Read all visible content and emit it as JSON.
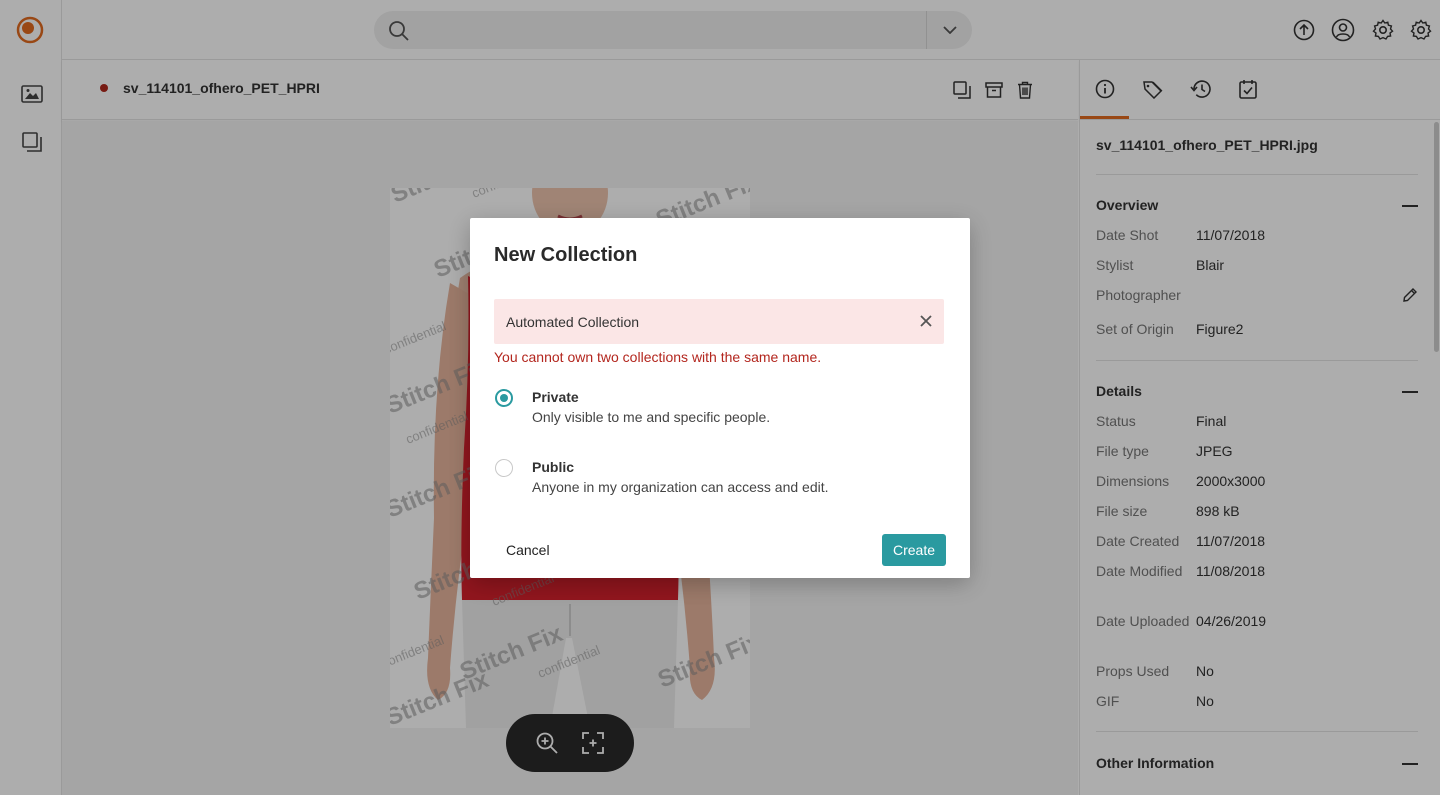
{
  "app": {
    "logo_icon": "app-logo",
    "accent_color": "#e26a1f"
  },
  "left_rail": {
    "items": [
      {
        "icon": "image-icon"
      },
      {
        "icon": "collections-icon"
      }
    ]
  },
  "top_bar": {
    "search": {
      "value": "",
      "placeholder": ""
    },
    "icons": [
      "upload-icon",
      "user-icon",
      "gear-icon",
      "settings-icon"
    ]
  },
  "asset_header": {
    "title": "sv_114101_ofhero_PET_HPRI",
    "status_color": "#b0281c",
    "actions": [
      "copy-icon",
      "archive-icon",
      "trash-icon"
    ]
  },
  "viewer": {
    "controls": [
      "zoom-in-icon",
      "fit-screen-icon"
    ]
  },
  "right_panel": {
    "tabs": [
      "info-icon",
      "tags-icon",
      "history-icon",
      "tasks-icon"
    ],
    "active_tab": "info-icon",
    "file_name": "sv_114101_ofhero_PET_HPRI.jpg",
    "overview": {
      "title": "Overview",
      "rows": [
        {
          "label": "Date Shot",
          "value": "11/07/2018"
        },
        {
          "label": "Stylist",
          "value": "Blair"
        },
        {
          "label": "Photographer",
          "value": ""
        },
        {
          "label": "Set of Origin",
          "value": "Figure2"
        }
      ]
    },
    "details": {
      "title": "Details",
      "rows": [
        {
          "label": "Status",
          "value": "Final"
        },
        {
          "label": "File type",
          "value": "JPEG"
        },
        {
          "label": "Dimensions",
          "value": "2000x3000"
        },
        {
          "label": "File size",
          "value": "898 kB"
        },
        {
          "label": "Date Created",
          "value": "11/07/2018"
        },
        {
          "label": "Date Modified",
          "value": "11/08/2018"
        },
        {
          "label": "Date Uploaded",
          "value": "04/26/2019"
        },
        {
          "label": "Props Used",
          "value": "No"
        },
        {
          "label": "GIF",
          "value": "No"
        }
      ]
    },
    "other": {
      "title": "Other Information"
    }
  },
  "modal": {
    "title": "New Collection",
    "name_value": "Automated Collection",
    "error": "You cannot own two collections with the same name.",
    "options": [
      {
        "title": "Private",
        "desc": "Only visible to me and specific people.",
        "checked": true
      },
      {
        "title": "Public",
        "desc": "Anyone in my organization can access and edit.",
        "checked": false
      }
    ],
    "cancel_label": "Cancel",
    "create_label": "Create",
    "error_color": "#b3261e",
    "primary_color": "#2a9aa0"
  }
}
